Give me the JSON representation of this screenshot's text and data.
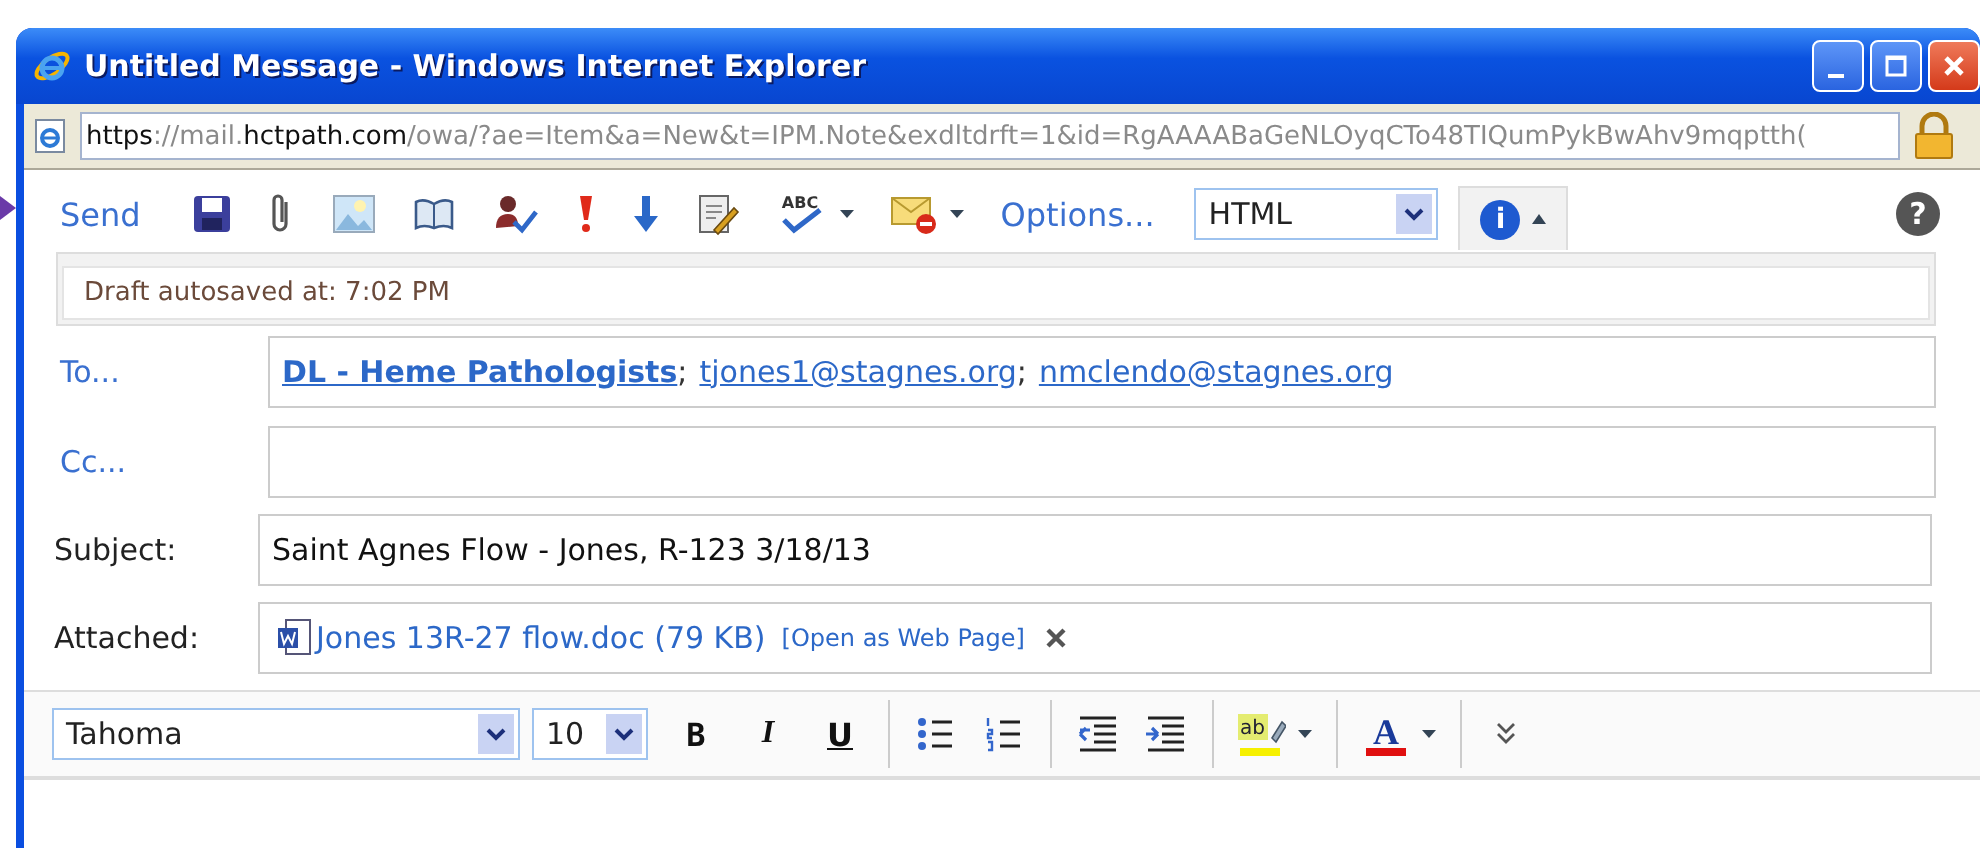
{
  "window": {
    "title": "Untitled Message - Windows Internet Explorer"
  },
  "address_bar": {
    "segments": [
      {
        "text": "https",
        "emphasis": true
      },
      {
        "text": "://mail.",
        "emphasis": false
      },
      {
        "text": "hctpath.com",
        "emphasis": true
      },
      {
        "text": "/owa/?ae=Item&a=New&t=IPM.Note&exdltdrft=1&id=RgAAAABaGeNLOyqCTo48TIQumPykBwAhv9mqptth(",
        "emphasis": false
      }
    ]
  },
  "toolbar": {
    "items": [
      {
        "kind": "send",
        "label": "Send"
      },
      {
        "kind": "save"
      },
      {
        "kind": "attach"
      },
      {
        "kind": "image"
      },
      {
        "kind": "book"
      },
      {
        "kind": "check-names"
      },
      {
        "kind": "high"
      },
      {
        "kind": "low"
      },
      {
        "kind": "signature"
      },
      {
        "kind": "spell",
        "label": "ABC"
      },
      {
        "kind": "envelope"
      },
      {
        "kind": "options",
        "label": "Options..."
      },
      {
        "kind": "format",
        "label": "HTML"
      },
      {
        "kind": "info",
        "label": "i",
        "selected": true
      }
    ],
    "help": "?"
  },
  "info_bar": {
    "text": "Draft autosaved at: 7:02 PM"
  },
  "to": {
    "label": "To...",
    "recipients": [
      {
        "text": "DL - Heme Pathologists",
        "kind": "group",
        "separator": ";"
      },
      {
        "text": "tjones1@stagnes.org",
        "kind": "address",
        "separator": ";"
      },
      {
        "text": "nmclendo@stagnes.org",
        "kind": "address"
      }
    ]
  },
  "cc": {
    "label": "Cc..."
  },
  "subject": {
    "label": "Subject:",
    "value": "Saint Agnes Flow - Jones, R-123 3/18/13"
  },
  "attached": {
    "label": "Attached:",
    "file": "Jones 13R-27 flow.doc (79 KB)",
    "open_link": "[Open as Web Page]"
  },
  "format_toolbar": {
    "font": "Tahoma",
    "size": "10",
    "items": [
      {
        "kind": "bold",
        "label": "B"
      },
      {
        "kind": "italic",
        "label": "I"
      },
      {
        "kind": "underline",
        "label": "U"
      },
      {
        "kind": "sep"
      },
      {
        "kind": "bullets"
      },
      {
        "kind": "numbering"
      },
      {
        "kind": "sep"
      },
      {
        "kind": "outdent"
      },
      {
        "kind": "indent"
      },
      {
        "kind": "sep"
      },
      {
        "kind": "highlight",
        "label": "ab"
      },
      {
        "kind": "sep"
      },
      {
        "kind": "fontcolor",
        "label": "A"
      },
      {
        "kind": "sep"
      },
      {
        "kind": "more"
      }
    ]
  }
}
